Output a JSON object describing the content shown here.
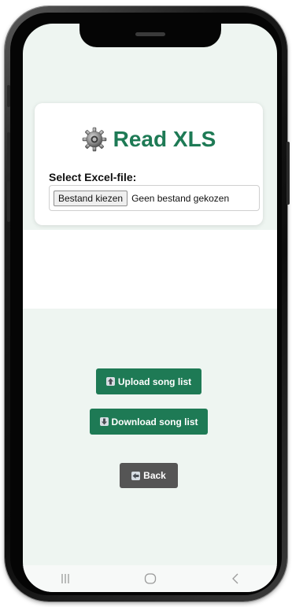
{
  "app": {
    "title": "Read XLS",
    "brand_color": "#1e7a55",
    "icon": "gear-icon"
  },
  "file_picker": {
    "label": "Select Excel-file:",
    "button_label": "Bestand kiezen",
    "status": "Geen bestand gekozen"
  },
  "actions": {
    "upload": {
      "icon": "up-arrow-icon",
      "label": "Upload song list"
    },
    "download": {
      "icon": "down-arrow-icon",
      "label": "Download song list"
    },
    "back": {
      "icon": "left-arrow-icon",
      "label": "Back"
    }
  },
  "nav_bar": {
    "items": [
      "recent-apps-icon",
      "home-icon",
      "back-nav-icon"
    ]
  }
}
